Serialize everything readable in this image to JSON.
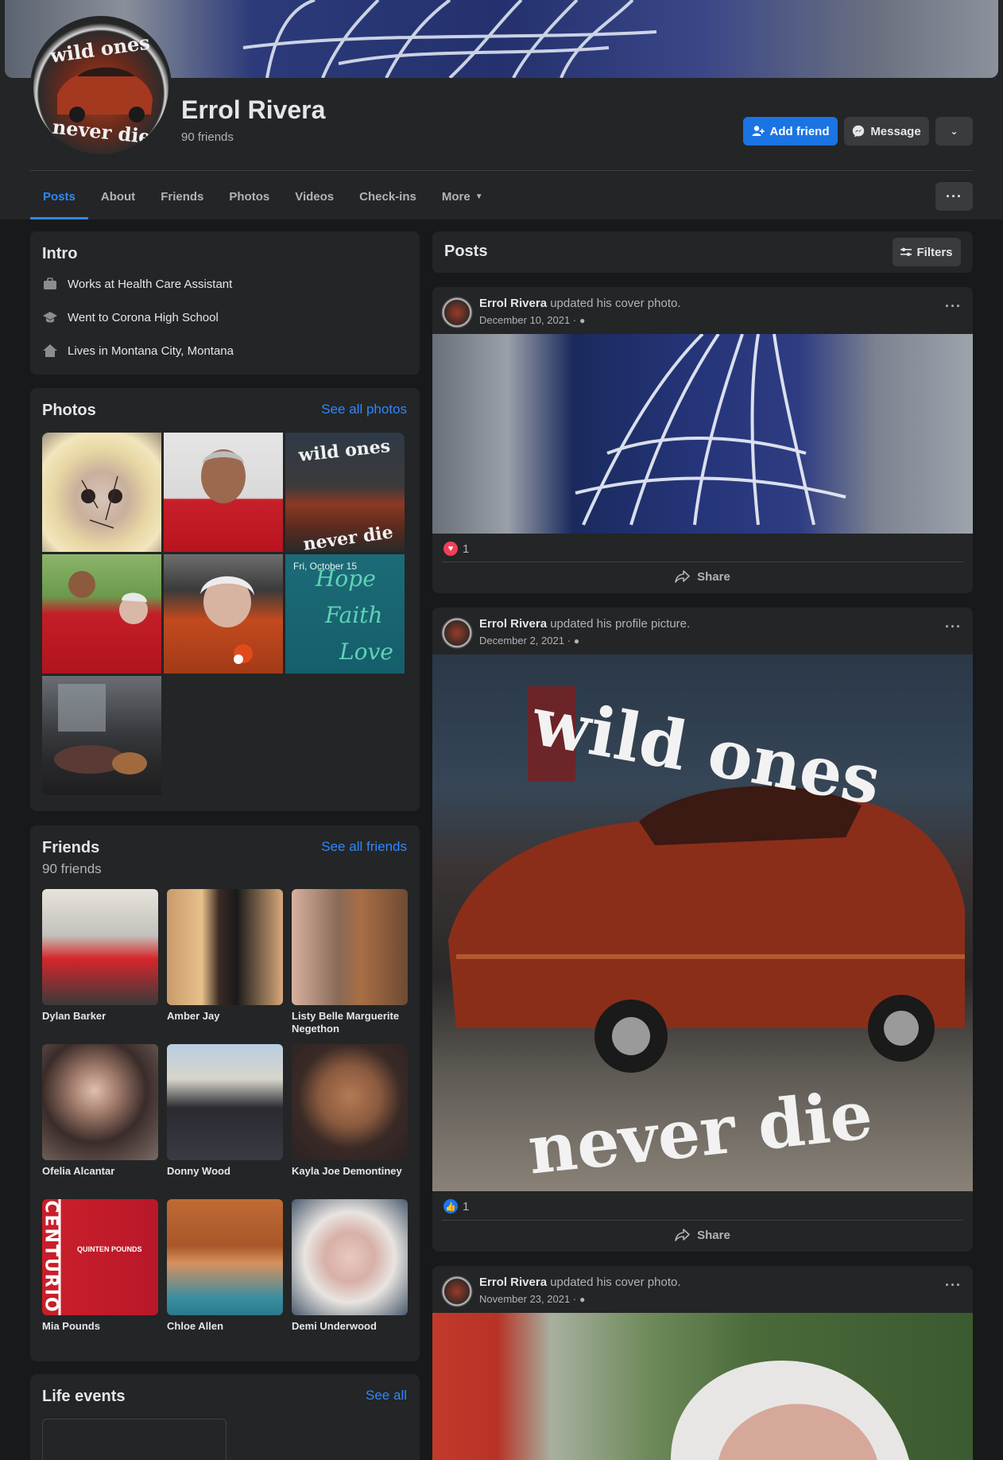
{
  "profile": {
    "name": "Errol Rivera",
    "friend_count": "90 friends",
    "add_friend_label": "Add friend",
    "message_label": "Message",
    "avatar_text_top": "wild ones",
    "avatar_text_bottom": "never die"
  },
  "tabs": [
    {
      "label": "Posts",
      "active": true
    },
    {
      "label": "About"
    },
    {
      "label": "Friends"
    },
    {
      "label": "Photos"
    },
    {
      "label": "Videos"
    },
    {
      "label": "Check-ins"
    },
    {
      "label": "More"
    }
  ],
  "intro": {
    "title": "Intro",
    "items": [
      {
        "icon": "briefcase-icon",
        "text": "Works at Health Care Assistant"
      },
      {
        "icon": "graduation-cap-icon",
        "text": "Went to Corona High School"
      },
      {
        "icon": "home-icon",
        "text": "Lives in Montana City, Montana"
      }
    ]
  },
  "photos": {
    "title": "Photos",
    "see_all": "See all photos",
    "overlay_date": "Fri, October 15",
    "overlay_words": [
      "Hope",
      "Faith",
      "Love"
    ]
  },
  "friends": {
    "title": "Friends",
    "count": "90 friends",
    "see_all": "See all friends",
    "list": [
      {
        "name": "Dylan Barker"
      },
      {
        "name": "Amber Jay"
      },
      {
        "name": "Listy Belle Marguerite Negethon"
      },
      {
        "name": "Ofelia Alcantar"
      },
      {
        "name": "Donny Wood"
      },
      {
        "name": "Kayla Joe Demontiney"
      },
      {
        "name": "Mia Pounds"
      },
      {
        "name": "Chloe Allen"
      },
      {
        "name": "Demi Underwood"
      }
    ],
    "mia_card_text": "CENTURIO",
    "mia_card_sub": "QUINTEN POUNDS"
  },
  "life_events": {
    "title": "Life events",
    "see_all": "See all"
  },
  "posts": {
    "title": "Posts",
    "filters_label": "Filters",
    "share_label": "Share",
    "items": [
      {
        "author": "Errol Rivera",
        "action": "updated his cover photo.",
        "date": "December 10, 2021 ·",
        "reaction": "love",
        "reaction_count": "1"
      },
      {
        "author": "Errol Rivera",
        "action": "updated his profile picture.",
        "date": "December 2, 2021 ·",
        "reaction": "like",
        "reaction_count": "1",
        "image_text_top": "wild ones",
        "image_text_bottom": "never die"
      },
      {
        "author": "Errol Rivera",
        "action": "updated his cover photo.",
        "date": "November 23, 2021 ·"
      }
    ]
  },
  "colors": {
    "background": "#18191a",
    "card": "#242526",
    "accent": "#2d88ff",
    "primary_button": "#1b74e4",
    "secondary_button": "#3a3b3c",
    "love": "#f33e58",
    "like": "#1877f2"
  }
}
